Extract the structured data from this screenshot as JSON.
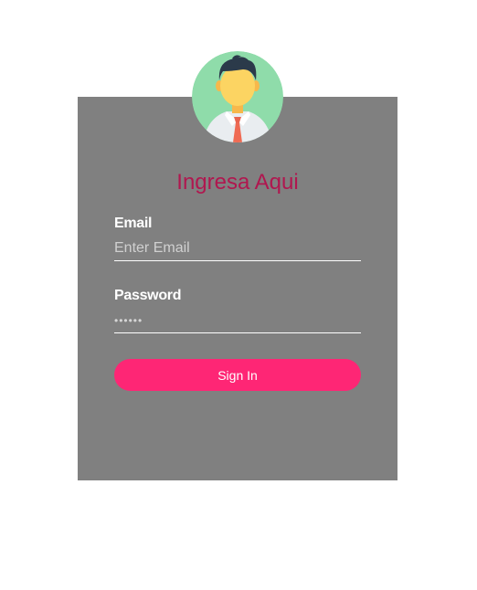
{
  "login": {
    "title": "Ingresa Aqui",
    "email_label": "Email",
    "email_placeholder": "Enter Email",
    "password_label": "Password",
    "password_placeholder": "••••••",
    "submit_label": "Sign In"
  },
  "avatar": {
    "icon": "user-avatar-icon"
  },
  "colors": {
    "card_background": "#808080",
    "title": "#b0174f",
    "button": "#fe2675",
    "avatar_background": "#8fdcaa"
  }
}
